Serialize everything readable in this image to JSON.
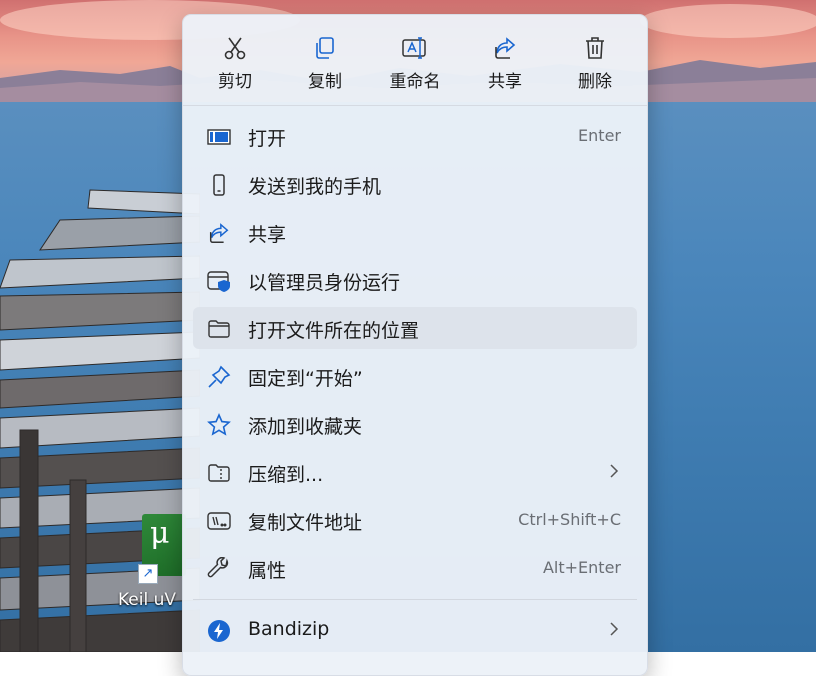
{
  "colors": {
    "menu_bg": "#ecf1f8",
    "hover_bg": "#dde3eb",
    "accent_blue": "#1a66d0",
    "text": "#1b1b1b",
    "accel_text": "#6a6e74"
  },
  "quick_actions": [
    {
      "label": "剪切",
      "icon": "scissors-icon"
    },
    {
      "label": "复制",
      "icon": "copy-icon"
    },
    {
      "label": "重命名",
      "icon": "rename-icon"
    },
    {
      "label": "共享",
      "icon": "share-icon"
    },
    {
      "label": "删除",
      "icon": "trash-icon"
    }
  ],
  "menu_items": [
    {
      "label": "打开",
      "accel": "Enter",
      "icon": "open-window-icon"
    },
    {
      "label": "发送到我的手机",
      "accel": "",
      "icon": "phone-icon"
    },
    {
      "label": "共享",
      "accel": "",
      "icon": "share-icon"
    },
    {
      "label": "以管理员身份运行",
      "accel": "",
      "icon": "admin-shield-icon"
    },
    {
      "label": "打开文件所在的位置",
      "accel": "",
      "icon": "folder-icon",
      "highlighted": true
    },
    {
      "label": "固定到“开始”",
      "accel": "",
      "icon": "pin-icon"
    },
    {
      "label": "添加到收藏夹",
      "accel": "",
      "icon": "star-icon"
    },
    {
      "label": "压缩到...",
      "accel": "",
      "icon": "zip-folder-icon",
      "submenu": true
    },
    {
      "label": "复制文件地址",
      "accel": "Ctrl+Shift+C",
      "icon": "copy-path-icon"
    },
    {
      "label": "属性",
      "accel": "Alt+Enter",
      "icon": "wrench-icon"
    },
    {
      "label": "Bandizip",
      "accel": "",
      "icon": "bandizip-icon",
      "submenu": true
    }
  ],
  "desktop": {
    "icon_label": "Keil uV",
    "icon_glyph": "μ"
  }
}
